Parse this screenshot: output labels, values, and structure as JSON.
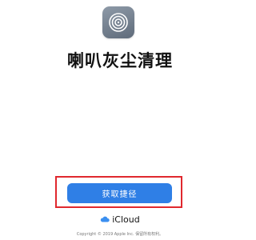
{
  "app": {
    "icon": "target-rings-icon",
    "title": "喇叭灰尘清理"
  },
  "action": {
    "button_label": "获取捷径",
    "highlight_color": "#e0282e",
    "button_color": "#2f7fe6"
  },
  "footer": {
    "brand_icon": "cloud-icon",
    "brand_label": "iCloud",
    "copyright": "Copyright © 2019 Apple Inc. 保留所有权利。"
  }
}
